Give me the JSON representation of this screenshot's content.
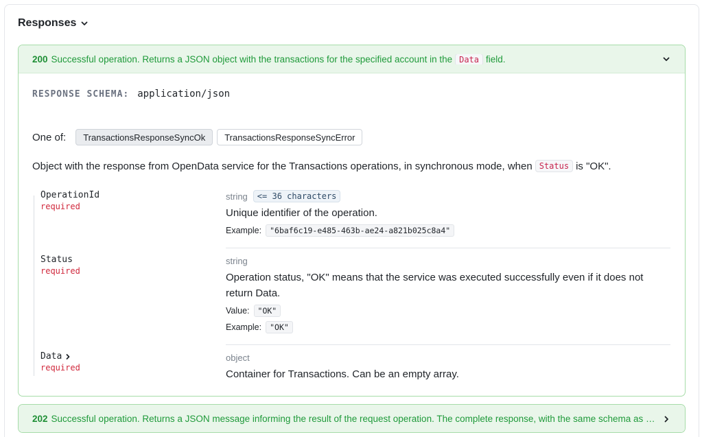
{
  "section": {
    "title": "Responses"
  },
  "responses": [
    {
      "code": "200",
      "summary_before": "Successful operation. Returns a JSON object with the transactions for the specified account in the",
      "summary_code": "Data",
      "summary_after": "field.",
      "expanded": true
    },
    {
      "code": "202",
      "summary": "Successful operation. Returns a JSON message informing the result of the request operation. The complete response, with the same schema as the sync…",
      "expanded": false
    }
  ],
  "schema": {
    "label": "RESPONSE SCHEMA:",
    "content_type": "application/json"
  },
  "one_of": {
    "label": "One of:",
    "options": [
      "TransactionsResponseSyncOk",
      "TransactionsResponseSyncError"
    ],
    "selected": "TransactionsResponseSyncOk"
  },
  "description": {
    "before": "Object with the response from OpenData service for the Transactions operations, in synchronous mode, when",
    "code": "Status",
    "after": "is \"OK\"."
  },
  "properties": [
    {
      "name": "OperationId",
      "required": "required",
      "type": "string",
      "constraint": "<= 36 characters",
      "description": "Unique identifier of the operation.",
      "example_label": "Example:",
      "example": "\"6baf6c19-e485-463b-ae24-a821b025c8a4\""
    },
    {
      "name": "Status",
      "required": "required",
      "type": "string",
      "description": "Operation status, \"OK\" means that the service was executed successfully even if it does not return Data.",
      "value_label": "Value:",
      "value": "\"OK\"",
      "example_label": "Example:",
      "example": "\"OK\""
    },
    {
      "name": "Data",
      "required": "required",
      "type": "object",
      "description": "Container for Transactions. Can be an empty array."
    }
  ],
  "colors": {
    "success_text": "#1f9a3a",
    "success_bg": "#e9f6ea",
    "success_border": "#a6dca8",
    "required": "#d0283c"
  }
}
